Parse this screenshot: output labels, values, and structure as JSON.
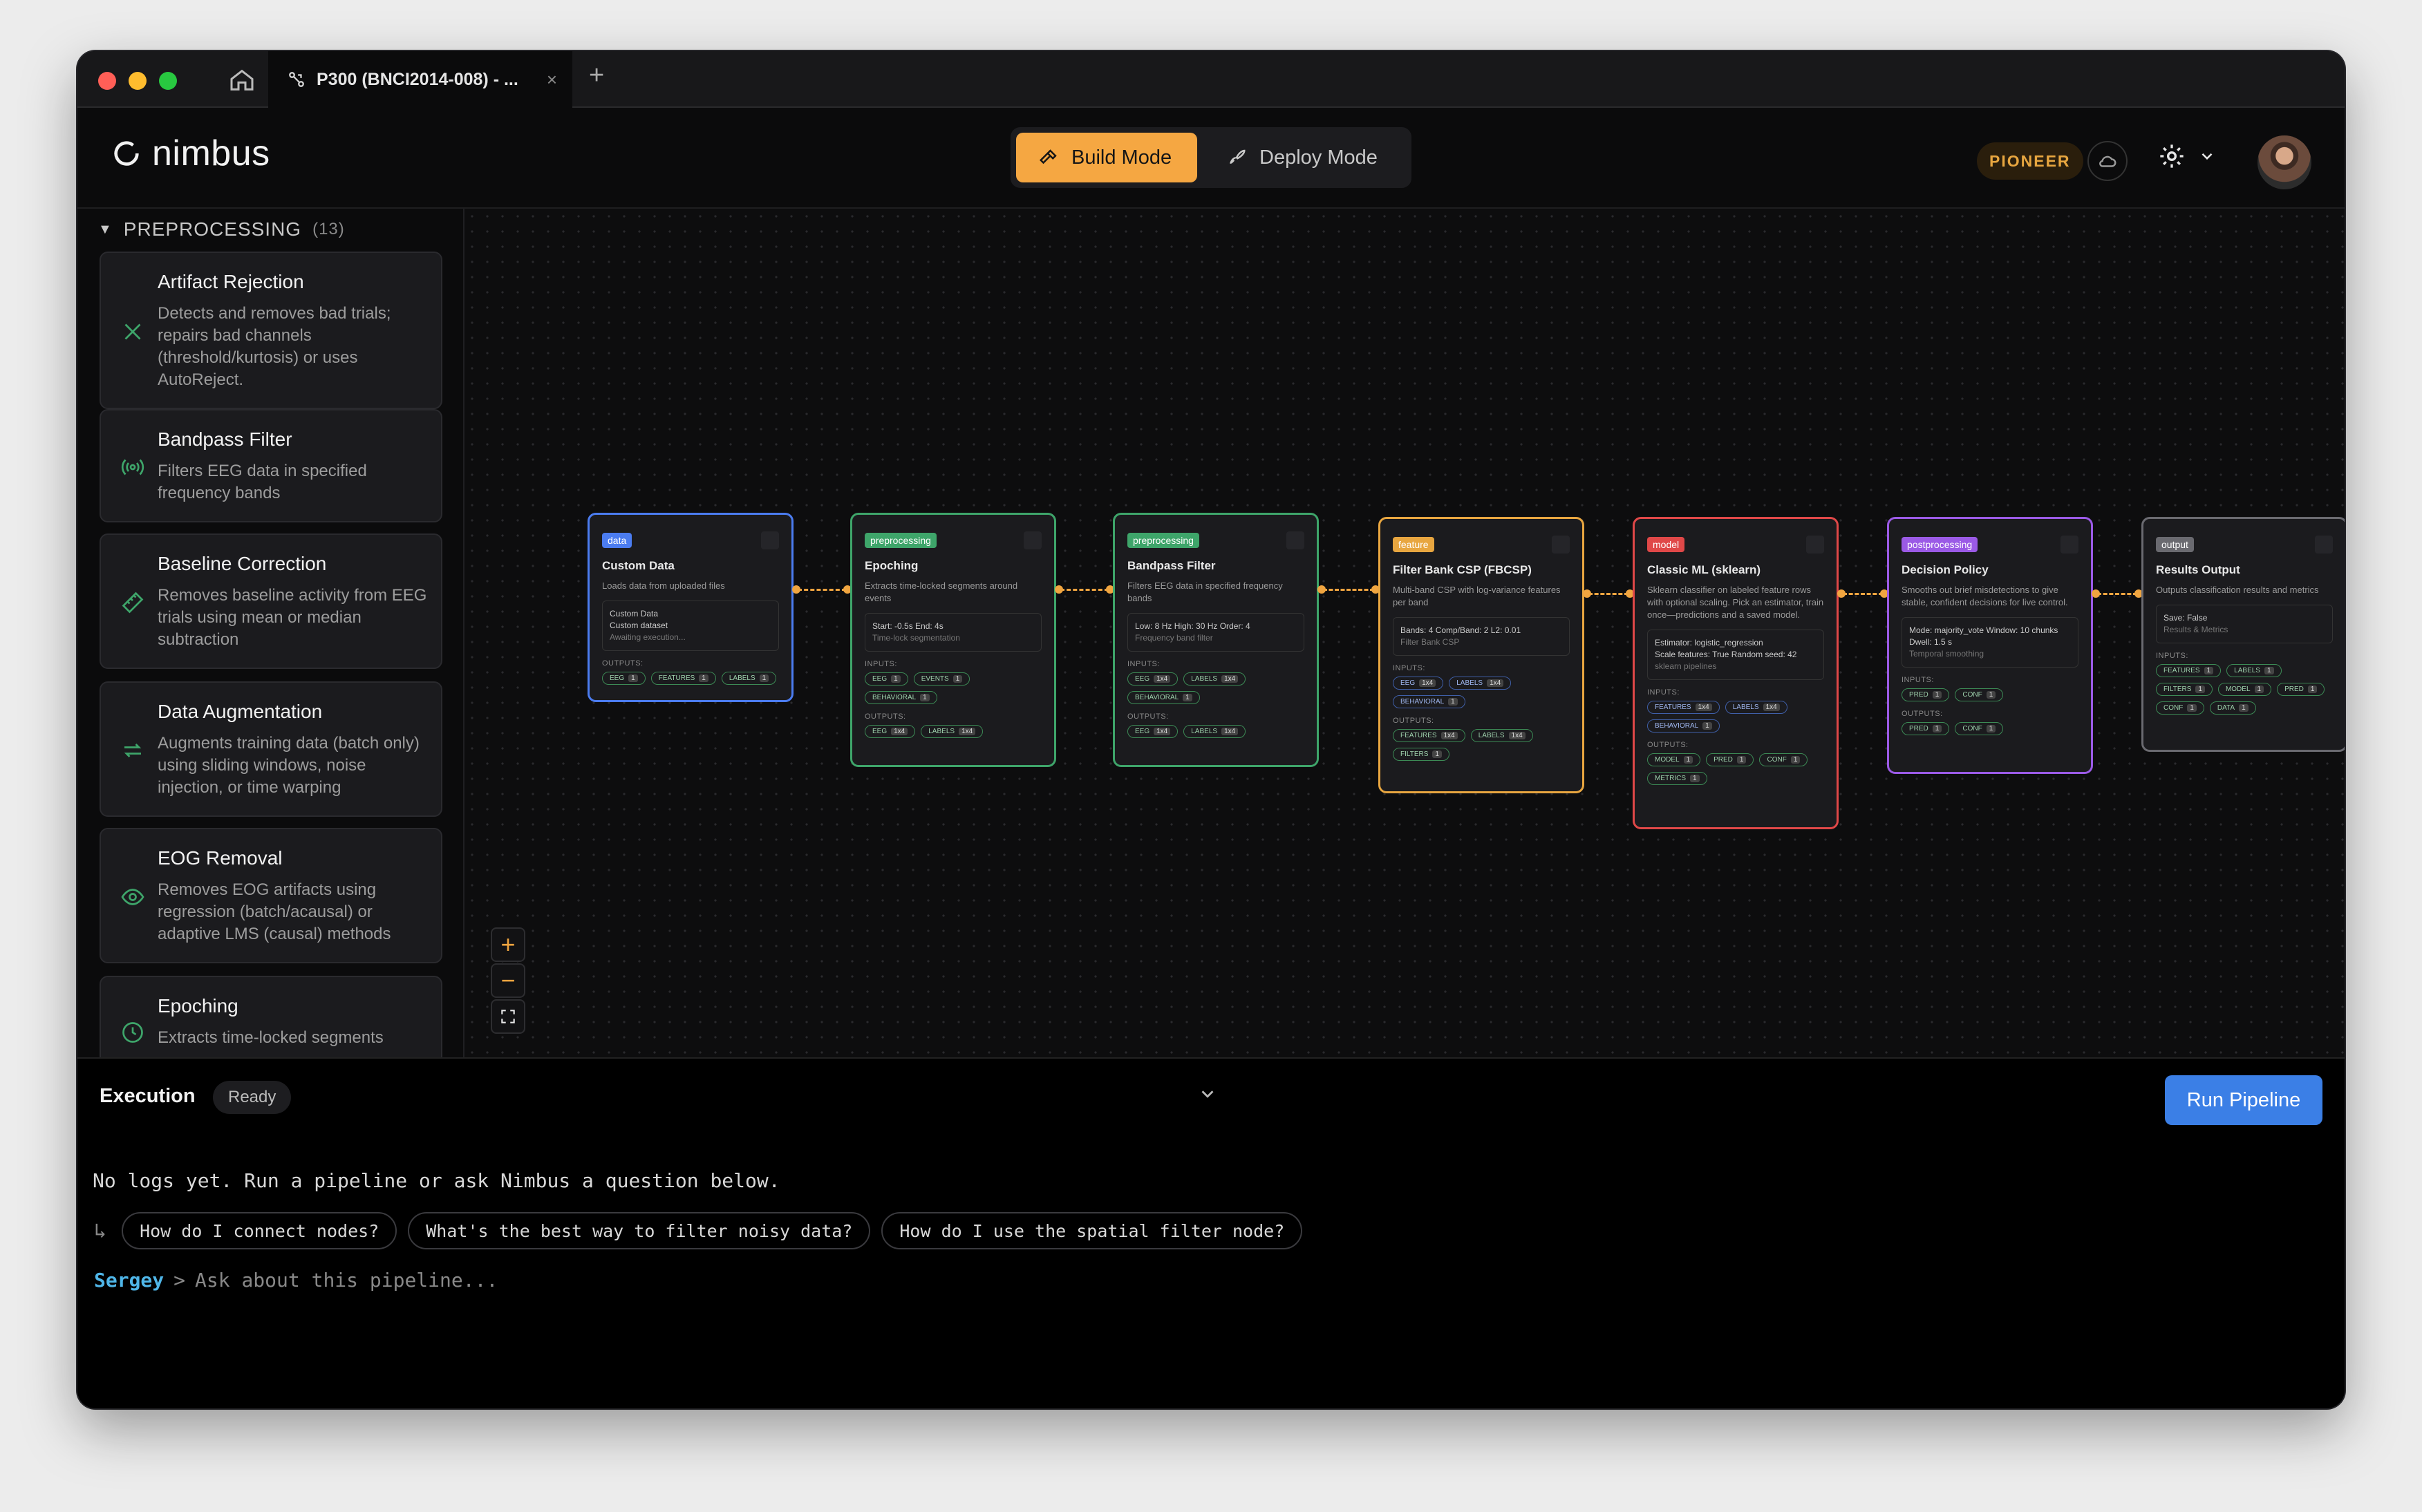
{
  "tab": {
    "title": "P300 (BNCI2014-008) - ..."
  },
  "app": {
    "name": "nimbus"
  },
  "modes": {
    "build": "Build Mode",
    "deploy": "Deploy Mode"
  },
  "header": {
    "tier_badge": "PIONEER"
  },
  "sidebar": {
    "section": "PREPROCESSING",
    "count": "(13)",
    "items": [
      {
        "title": "Artifact Rejection",
        "desc": "Detects and removes bad trials; repairs bad channels (threshold/kurtosis) or uses AutoReject.",
        "icon": "x-icon"
      },
      {
        "title": "Bandpass Filter",
        "desc": "Filters EEG data in specified frequency bands",
        "icon": "signal-icon"
      },
      {
        "title": "Baseline Correction",
        "desc": "Removes baseline activity from EEG trials using mean or median subtraction",
        "icon": "ruler-icon"
      },
      {
        "title": "Data Augmentation",
        "desc": "Augments training data (batch only) using sliding windows, noise injection, or time warping",
        "icon": "repeat-icon"
      },
      {
        "title": "EOG Removal",
        "desc": "Removes EOG artifacts using regression (batch/acausal) or adaptive LMS (causal) methods",
        "icon": "eye-icon"
      },
      {
        "title": "Epoching",
        "desc": "Extracts time-locked segments",
        "icon": "clock-icon"
      }
    ]
  },
  "nodes": [
    {
      "badge": "data",
      "color": "#4b7cf0",
      "title": "Custom Data",
      "desc": "Loads data from uploaded files",
      "box": [
        "Custom Data",
        "Custom dataset",
        "Awaiting execution..."
      ],
      "inputs": [],
      "outputs": [
        {
          "l": "EEG",
          "n": "1"
        },
        {
          "l": "FEATURES",
          "n": "1"
        },
        {
          "l": "LABELS",
          "n": "1"
        }
      ]
    },
    {
      "badge": "preprocessing",
      "color": "#3ea56a",
      "title": "Epoching",
      "desc": "Extracts time-locked segments around events",
      "box": [
        "Start: -0.5s   End: 4s",
        "Time-lock segmentation"
      ],
      "inputs": [
        {
          "l": "EEG",
          "n": "1"
        },
        {
          "l": "EVENTS",
          "n": "1"
        },
        {
          "l": "BEHAVIORAL",
          "n": "1"
        }
      ],
      "outputs": [
        {
          "l": "EEG",
          "n": "1x4"
        },
        {
          "l": "LABELS",
          "n": "1x4"
        }
      ]
    },
    {
      "badge": "preprocessing",
      "color": "#3ea56a",
      "title": "Bandpass Filter",
      "desc": "Filters EEG data in specified frequency bands",
      "box": [
        "Low: 8 Hz   High: 30 Hz   Order: 4",
        "Frequency band filter"
      ],
      "inputs": [
        {
          "l": "EEG",
          "n": "1x4"
        },
        {
          "l": "LABELS",
          "n": "1x4"
        },
        {
          "l": "BEHAVIORAL",
          "n": "1"
        }
      ],
      "outputs": [
        {
          "l": "EEG",
          "n": "1x4"
        },
        {
          "l": "LABELS",
          "n": "1x4"
        }
      ]
    },
    {
      "badge": "feature",
      "color": "#e8a640",
      "title": "Filter Bank CSP (FBCSP)",
      "desc": "Multi-band CSP with log-variance features per band",
      "box": [
        "Bands: 4   Comp/Band: 2   L2: 0.01",
        "Filter Bank CSP"
      ],
      "inputs": [
        {
          "l": "EEG",
          "n": "1x4"
        },
        {
          "l": "LABELS",
          "n": "1x4"
        },
        {
          "l": "BEHAVIORAL",
          "n": "1"
        }
      ],
      "outputs": [
        {
          "l": "FEATURES",
          "n": "1x4"
        },
        {
          "l": "LABELS",
          "n": "1x4"
        },
        {
          "l": "FILTERS",
          "n": "1"
        }
      ]
    },
    {
      "badge": "model",
      "color": "#e04848",
      "title": "Classic ML (sklearn)",
      "desc": "Sklearn classifier on labeled feature rows with optional scaling. Pick an estimator, train once—predictions and a saved model.",
      "box": [
        "Estimator: logistic_regression",
        "Scale features: True   Random seed: 42",
        "sklearn pipelines"
      ],
      "inputs": [
        {
          "l": "FEATURES",
          "n": "1x4"
        },
        {
          "l": "LABELS",
          "n": "1x4"
        },
        {
          "l": "BEHAVIORAL",
          "n": "1"
        }
      ],
      "outputs": [
        {
          "l": "MODEL",
          "n": "1"
        },
        {
          "l": "PRED",
          "n": "1"
        },
        {
          "l": "CONF",
          "n": "1"
        },
        {
          "l": "METRICS",
          "n": "1"
        }
      ]
    },
    {
      "badge": "postprocessing",
      "color": "#9b5ae6",
      "title": "Decision Policy",
      "desc": "Smooths out brief misdetections to give stable, confident decisions for live control.",
      "box": [
        "Mode: majority_vote   Window: 10 chunks",
        "Dwell: 1.5 s",
        "Temporal smoothing"
      ],
      "inputs": [
        {
          "l": "PRED",
          "n": "1"
        },
        {
          "l": "CONF",
          "n": "1"
        }
      ],
      "outputs": [
        {
          "l": "PRED",
          "n": "1"
        },
        {
          "l": "CONF",
          "n": "1"
        }
      ]
    },
    {
      "badge": "output",
      "color": "#6a6a70",
      "title": "Results Output",
      "desc": "Outputs classification results and metrics",
      "box": [
        "Save: False",
        "Results & Metrics"
      ],
      "inputs": [
        {
          "l": "FEATURES",
          "n": "1"
        },
        {
          "l": "LABELS",
          "n": "1"
        },
        {
          "l": "FILTERS",
          "n": "1"
        },
        {
          "l": "MODEL",
          "n": "1"
        },
        {
          "l": "PRED",
          "n": "1"
        },
        {
          "l": "CONF",
          "n": "1"
        },
        {
          "l": "DATA",
          "n": "1"
        }
      ],
      "outputs": []
    }
  ],
  "labels": {
    "inputs": "INPUTS:",
    "outputs": "OUTPUTS:"
  },
  "execution": {
    "title": "Execution",
    "status": "Ready",
    "run_label": "Run Pipeline",
    "log": "No logs yet. Run a pipeline or ask Nimbus a question below.",
    "suggestions": [
      "How do I connect nodes?",
      "What's the best way to filter noisy data?",
      "How do I use the spatial filter node?"
    ],
    "user": "Sergey",
    "placeholder": "Ask about this pipeline..."
  }
}
